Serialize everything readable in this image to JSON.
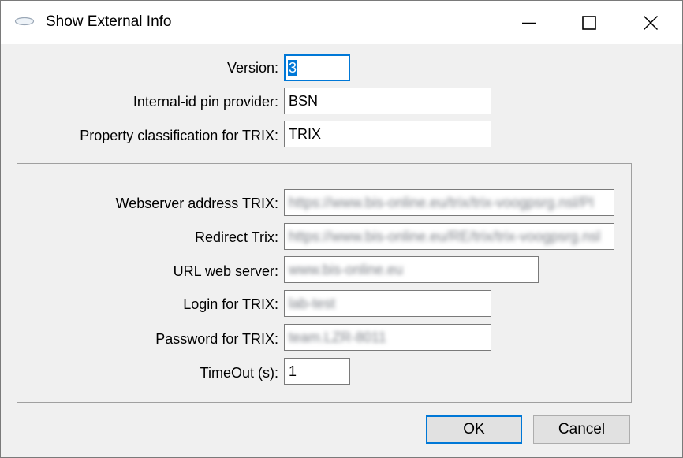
{
  "window": {
    "title": "Show External Info"
  },
  "icons": {
    "app": "app-oval-icon",
    "minimize": "minimize-icon",
    "maximize": "maximize-icon",
    "close": "close-icon"
  },
  "form": {
    "version": {
      "label": "Version:",
      "value": "3"
    },
    "pin_provider": {
      "label": "Internal-id pin provider:",
      "value": "BSN"
    },
    "property_classification": {
      "label": "Property classification for TRIX:",
      "value": "TRIX"
    }
  },
  "group": {
    "webserver_address": {
      "label": "Webserver address TRIX:",
      "value": "https://www.bis-online.eu/trix/trix-voogpsrg.nsl/PI"
    },
    "redirect": {
      "label": "Redirect Trix:",
      "value": "https://www.bis-online.eu/RE/trix/trix-voogpsrg.nsl"
    },
    "url_web_server": {
      "label": "URL web server:",
      "value": "www.bis-online.eu"
    },
    "login": {
      "label": "Login for TRIX:",
      "value": "lab-test"
    },
    "password": {
      "label": "Password for TRIX:",
      "value": "team.LZR-8011"
    },
    "timeout": {
      "label": "TimeOut (s):",
      "value": "1"
    }
  },
  "buttons": {
    "ok": "OK",
    "cancel": "Cancel"
  },
  "colors": {
    "accent": "#0078d7",
    "dialog_bg": "#f0f0f0"
  }
}
